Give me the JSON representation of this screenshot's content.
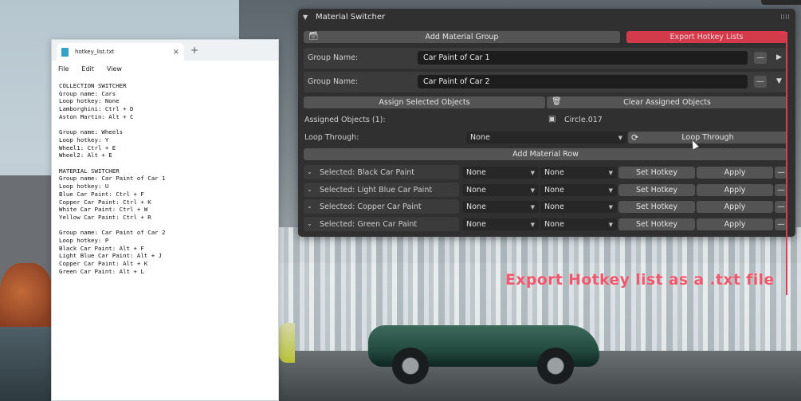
{
  "notepad": {
    "tab_title": "hotkey_list.txt",
    "close_glyph": "×",
    "add_glyph": "+",
    "menu": [
      "File",
      "Edit",
      "View"
    ],
    "content": "COLLECTION SWITCHER\nGroup name: Cars\nLoop hotkey: None\nLamborghini: Ctrl + D\nAston Martin: Alt + C\n\nGroup name: Wheels\nLoop hotkey: Y\nWheel1: Ctrl + E\nWheel2: Alt + E\n\nMATERIAL SWITCHER\nGroup name: Car Paint of Car 1\nLoop hotkey: U\nBlue Car Paint: Ctrl + F\nCopper Car Paint: Ctrl + K\nWhite Car Paint: Ctrl + W\nYellow Car Paint: Ctrl + R\n\nGroup name: Car Paint of Car 2\nLoop hotkey: P\nBlack Car Paint: Alt + F\nLight Blue Car Paint: Alt + J\nCopper Car Paint: Alt + K\nGreen Car Paint: Alt + L"
  },
  "panel": {
    "title": "Material Switcher",
    "add_group_label": "Add Material Group",
    "export_label": "Export Hotkey Lists",
    "groups": [
      {
        "label": "Group Name:",
        "value": "Car Paint of Car 1",
        "minus": "—",
        "arrow": "▶"
      },
      {
        "label": "Group Name:",
        "value": "Car Paint of Car 2",
        "minus": "—",
        "arrow": "▼"
      }
    ],
    "assign_label": "Assign Selected Objects",
    "clear_label": "Clear Assigned Objects",
    "assigned_label": "Assigned Objects (1):",
    "assigned_object": "Circle.017",
    "loop_label": "Loop Through:",
    "loop_value": "None",
    "loop_button": "Loop Through",
    "add_row_label": "Add Material Row",
    "rows": [
      {
        "label": "Selected: Black Car Paint",
        "opt1": "None",
        "opt2": "None",
        "hotkey": "Set Hotkey",
        "apply": "Apply"
      },
      {
        "label": "Selected: Light Blue Car Paint",
        "opt1": "None",
        "opt2": "None",
        "hotkey": "Set Hotkey",
        "apply": "Apply"
      },
      {
        "label": "Selected: Copper Car Paint",
        "opt1": "None",
        "opt2": "None",
        "hotkey": "Set Hotkey",
        "apply": "Apply"
      },
      {
        "label": "Selected: Green Car Paint",
        "opt1": "None",
        "opt2": "None",
        "hotkey": "Set Hotkey",
        "apply": "Apply"
      }
    ]
  },
  "annotation": "Export Hotkey list as a .txt file",
  "colors": {
    "accent_red": "#d33b4a",
    "annotation_red": "#f2586d",
    "panel_bg": "#303030"
  }
}
